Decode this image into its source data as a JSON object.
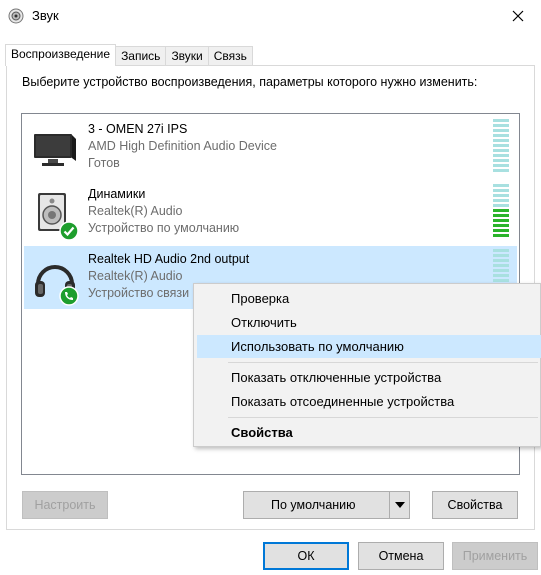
{
  "window": {
    "title": "Звук",
    "title_icon": "speaker-icon",
    "close_icon": "close-icon"
  },
  "tabs": [
    {
      "label": "Воспроизведение",
      "active": true
    },
    {
      "label": "Запись",
      "active": false
    },
    {
      "label": "Звуки",
      "active": false
    },
    {
      "label": "Связь",
      "active": false
    }
  ],
  "instruction": "Выберите устройство воспроизведения, параметры которого нужно изменить:",
  "devices": [
    {
      "name": "3 - OMEN 27i IPS",
      "driver": "AMD High Definition Audio Device",
      "status": "Готов",
      "icon": "monitor-icon",
      "badge": "",
      "level_segments_lit": 0
    },
    {
      "name": "Динамики",
      "driver": "Realtek(R) Audio",
      "status": "Устройство по умолчанию",
      "icon": "speaker-device-icon",
      "badge": "default-check-icon",
      "level_segments_lit": 6
    },
    {
      "name": "Realtek HD Audio 2nd output",
      "driver": "Realtek(R) Audio",
      "status": "Устройство связи",
      "icon": "headphones-icon",
      "badge": "communication-phone-icon",
      "level_segments_lit": 0,
      "selected": true
    }
  ],
  "buttons": {
    "configure": "Настроить",
    "set_default": "По умолчанию",
    "properties": "Свойства",
    "ok": "ОК",
    "cancel": "Отмена",
    "apply": "Применить"
  },
  "context_menu": {
    "items": [
      {
        "label": "Проверка"
      },
      {
        "label": "Отключить"
      },
      {
        "label": "Использовать по умолчанию",
        "highlighted": true
      },
      {
        "label": "Показать отключенные устройства"
      },
      {
        "label": "Показать отсоединенные устройства"
      },
      {
        "label": "Свойства",
        "bold": true
      }
    ]
  },
  "colors": {
    "selection": "#cce8ff",
    "accent": "#0078d7",
    "level_on": "#2bb42b",
    "level_off": "#a8e0e0",
    "badge_green": "#1e9e2d"
  }
}
